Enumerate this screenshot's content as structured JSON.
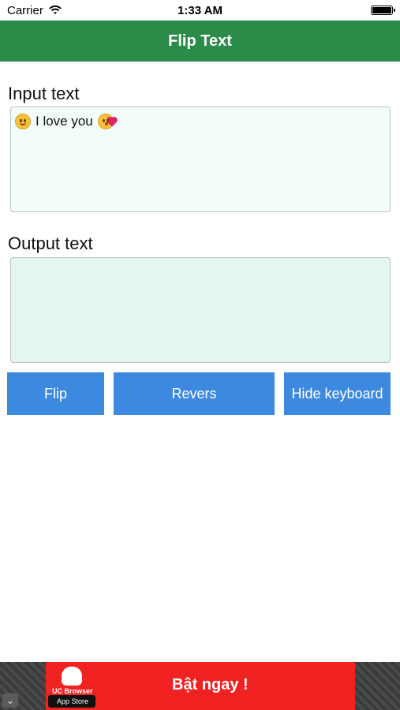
{
  "status_bar": {
    "carrier": "Carrier",
    "time": "1:33 AM"
  },
  "nav": {
    "title": "Flip Text"
  },
  "input": {
    "label": "Input text",
    "value": "I love you"
  },
  "output": {
    "label": "Output text",
    "value": ""
  },
  "buttons": {
    "flip": "Flip",
    "revers": "Revers",
    "hide_keyboard": "Hide keyboard"
  },
  "ad": {
    "brand": "UC Browser",
    "store": "App Store",
    "cta": "Bật ngay !"
  },
  "colors": {
    "nav_bg": "#2b8b48",
    "button_bg": "#3d89e0",
    "ad_bg": "#f12222"
  },
  "icons": {
    "smile": "smiling-face-icon",
    "kiss": "face-blowing-kiss-icon"
  }
}
